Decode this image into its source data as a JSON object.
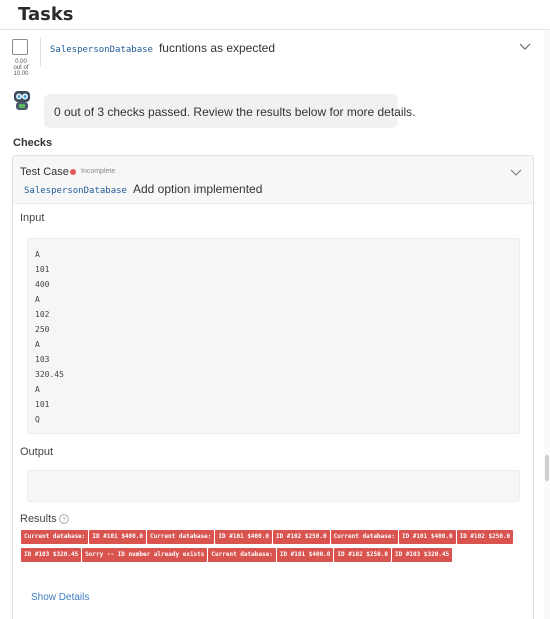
{
  "header": {
    "title": "Tasks"
  },
  "task": {
    "score_line1": "0.00",
    "score_line2": "out of",
    "score_line3": "10.00",
    "class_name": "SalespersonDatabase",
    "title_rest": "fucntions as expected"
  },
  "bot": {
    "message": "0 out of 3 checks passed. Review the results below for more details."
  },
  "checks": {
    "label": "Checks",
    "test_case": {
      "label": "Test Case",
      "status": "Incomplete",
      "status_color": "#e05a5a",
      "class_name": "SalespersonDatabase",
      "title_rest": "Add option implemented",
      "input_label": "Input",
      "input_lines": [
        "A",
        "101",
        "400",
        "A",
        "102",
        "250",
        "A",
        "103",
        "320.45",
        "A",
        "101",
        "Q"
      ],
      "output_label": "Output",
      "results_label": "Results",
      "results": [
        "Current database:",
        "ID #101 $400.0",
        "Current database:",
        "ID #101 $400.0",
        "ID #102 $250.0",
        "Current database:",
        "ID #101 $400.0",
        "ID #102 $250.0",
        "ID #103 $320.45",
        "Sorry -- ID number already exists",
        "Current database:",
        "ID #101 $400.0",
        "ID #102 $250.0",
        "ID #103 $320.45"
      ],
      "result_color": "#d9534f",
      "show_details": "Show Details"
    }
  }
}
